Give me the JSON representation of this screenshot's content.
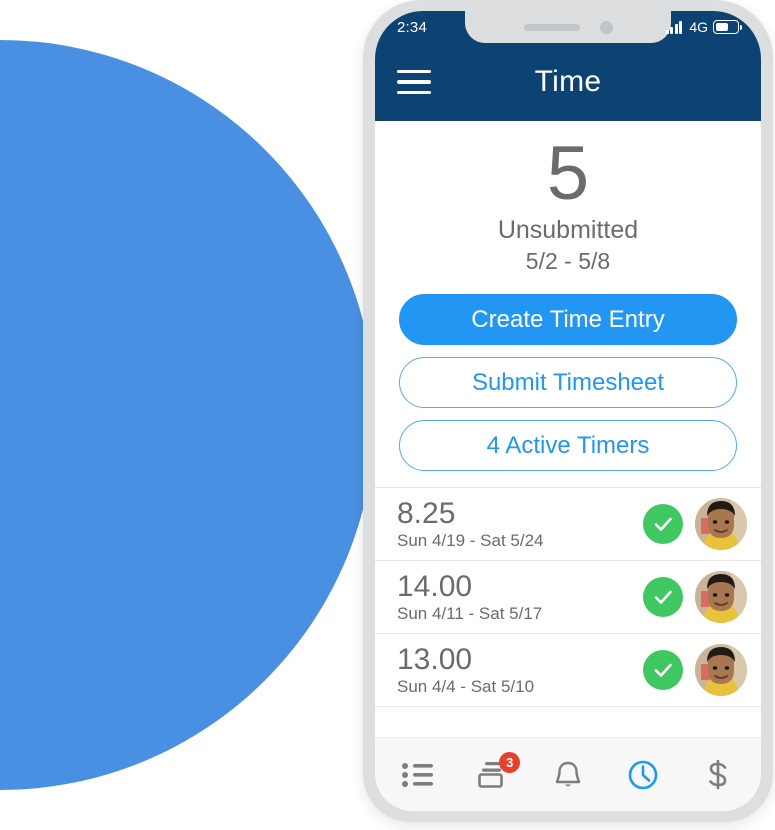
{
  "phone": {
    "status_bar": {
      "time": "2:34",
      "network": "4G",
      "signal_icon": "signal-bars-icon",
      "battery_icon": "battery-icon"
    },
    "nav": {
      "menu_icon": "hamburger-menu-icon",
      "title": "Time"
    }
  },
  "summary": {
    "count": "5",
    "label": "Unsubmitted",
    "date_range": "5/2 - 5/8"
  },
  "actions": [
    {
      "label": "Create Time Entry",
      "style": "primary",
      "name": "create-time-entry-button"
    },
    {
      "label": "Submit Timesheet",
      "style": "outline",
      "name": "submit-timesheet-button"
    },
    {
      "label": "4 Active Timers",
      "style": "outline",
      "name": "active-timers-button"
    }
  ],
  "timesheets": [
    {
      "hours": "8.25",
      "range": "Sun 4/19 - Sat 5/24",
      "status_icon": "check-circle-icon",
      "avatar_icon": "user-avatar-photo"
    },
    {
      "hours": "14.00",
      "range": "Sun 4/11 - Sat 5/17",
      "status_icon": "check-circle-icon",
      "avatar_icon": "user-avatar-photo"
    },
    {
      "hours": "13.00",
      "range": "Sun 4/4 - Sat 5/10",
      "status_icon": "check-circle-icon",
      "avatar_icon": "user-avatar-photo"
    }
  ],
  "tabs": [
    {
      "icon": "bulleted-list-icon",
      "name": "tab-list",
      "badge": "",
      "active": false
    },
    {
      "icon": "card-stack-icon",
      "name": "tab-expenses",
      "badge": "3",
      "active": false
    },
    {
      "icon": "bell-icon",
      "name": "tab-notifications",
      "badge": "",
      "active": false
    },
    {
      "icon": "clock-icon",
      "name": "tab-time",
      "badge": "",
      "active": true
    },
    {
      "icon": "dollar-sign-icon",
      "name": "tab-billing",
      "badge": "",
      "active": false
    }
  ],
  "colors": {
    "header_navy": "#0d4372",
    "accent_blue": "#2196f3",
    "background_circle": "#4a90e2",
    "success_green": "#3fc761",
    "badge_red": "#e8402a",
    "text_gray": "#6b6b6b",
    "tab_inactive": "#7d7d7d"
  }
}
